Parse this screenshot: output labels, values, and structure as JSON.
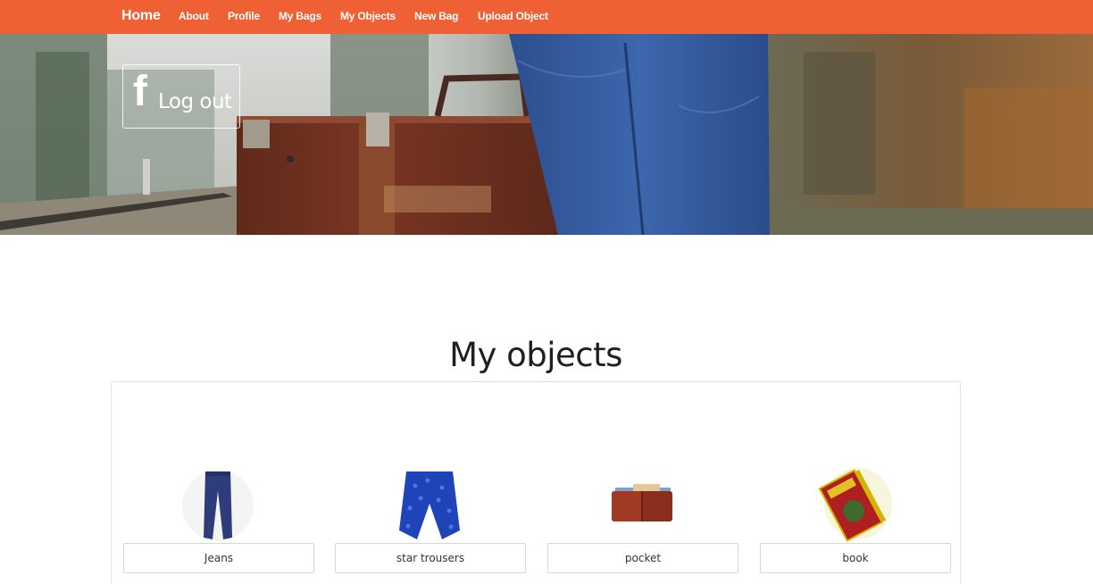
{
  "navbar": {
    "brand": "Home",
    "links": [
      "About",
      "Profile",
      "My Bags",
      "My Objects",
      "New Bag",
      "Upload Object"
    ],
    "color": "#ef6034"
  },
  "hero": {
    "logout_button": {
      "icon": "facebook-icon",
      "glyph": "f",
      "label": "Log out"
    }
  },
  "main": {
    "title": "My objects",
    "objects": [
      {
        "name": "Jeans",
        "image": "jeans-image"
      },
      {
        "name": "star trousers",
        "image": "star-trousers-image"
      },
      {
        "name": "pocket",
        "image": "wallet-image"
      },
      {
        "name": "book",
        "image": "book-image"
      }
    ]
  }
}
